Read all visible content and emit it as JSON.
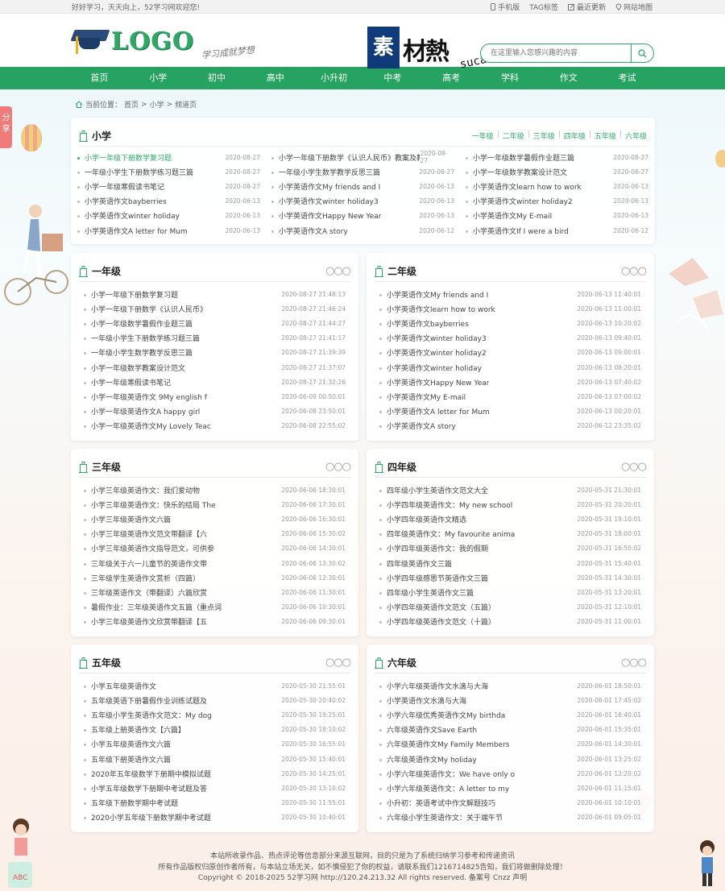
{
  "topbar": {
    "welcome": "好好学习，天天向上，52学习网欢迎您!",
    "links": [
      "手机版",
      "TAG标签",
      "最近更新",
      "网站地图"
    ]
  },
  "header": {
    "logo_text": "LOGO",
    "slogan": "学习成就梦想",
    "watermark_block": "素",
    "watermark_rest": "材熱",
    "watermark_domain": "sucaire.com",
    "search_placeholder": "在这里输入您感兴趣的内容"
  },
  "nav": [
    "首页",
    "小学",
    "初中",
    "高中",
    "小升初",
    "中考",
    "高考",
    "学科",
    "作文",
    "考试"
  ],
  "share": "分享",
  "breadcrumb": {
    "prefix": "当前位置：",
    "items": [
      "首页",
      "小学",
      "频道页"
    ],
    "sep": ">"
  },
  "top_card": {
    "title": "小学",
    "grades": [
      "一年级",
      "二年级",
      "三年级",
      "四年级",
      "五年级",
      "六年级"
    ],
    "columns": [
      [
        {
          "t": "小学一年级下册数学复习题",
          "d": "2020-08-27"
        },
        {
          "t": "一年级小学生下册数学练习题三篇",
          "d": "2020-08-27"
        },
        {
          "t": "小学一年级寒假读书笔记",
          "d": "2020-08-27"
        },
        {
          "t": "小学英语作文bayberries",
          "d": "2020-06-13"
        },
        {
          "t": "小学英语作文winter holiday",
          "d": "2020-06-13"
        },
        {
          "t": "小学英语作文A letter for Mum",
          "d": "2020-06-13"
        }
      ],
      [
        {
          "t": "小学一年级下册数学《认识人民币》教案及教",
          "d": "2020-08-27"
        },
        {
          "t": "一年级小学生数学教学反思三篇",
          "d": "2020-08-27"
        },
        {
          "t": "小学英语作文My friends and I",
          "d": "2020-06-13"
        },
        {
          "t": "小学英语作文winter holiday3",
          "d": "2020-06-13"
        },
        {
          "t": "小学英语作文Happy New Year",
          "d": "2020-06-13"
        },
        {
          "t": "小学英语作文A story",
          "d": "2020-06-12"
        }
      ],
      [
        {
          "t": "小学一年级数学暑假作业题三篇",
          "d": "2020-08-27"
        },
        {
          "t": "小学一年级数学教案设计范文",
          "d": "2020-08-27"
        },
        {
          "t": "小学英语作文learn how to work",
          "d": "2020-06-13"
        },
        {
          "t": "小学英语作文winter holiday2",
          "d": "2020-06-13"
        },
        {
          "t": "小学英语作文My E-mail",
          "d": "2020-06-13"
        },
        {
          "t": "小学英语作文If I were a bird",
          "d": "2020-06-12"
        }
      ]
    ]
  },
  "grade_cards": [
    {
      "title": "一年级",
      "more": "○○○",
      "items": [
        {
          "t": "小学一年级下册数学复习题",
          "d": "2020-08-27 21:48:13"
        },
        {
          "t": "小学一年级下册数学《认识人民币》",
          "d": "2020-08-27 21:46:24"
        },
        {
          "t": "小学一年级数学暑假作业题三篇",
          "d": "2020-08-27 21:44:27"
        },
        {
          "t": "一年级小学生下册数学练习题三篇",
          "d": "2020-08-27 21:41:17"
        },
        {
          "t": "一年级小学生数学教学反思三篇",
          "d": "2020-08-27 21:39:39"
        },
        {
          "t": "小学一年级数学教案设计范文",
          "d": "2020-08-27 21:37:07"
        },
        {
          "t": "小学一年级寒假读书笔记",
          "d": "2020-08-27 21:32:26"
        },
        {
          "t": "小学一年级英语作文 9My english f",
          "d": "2020-06-09 00:50:01"
        },
        {
          "t": "小学一年级英语作文A happy girl",
          "d": "2020-06-08 23:50:01"
        },
        {
          "t": "小学一年级英语作文My Lovely Teac",
          "d": "2020-06-08 22:55:02"
        }
      ]
    },
    {
      "title": "二年级",
      "more": "○○○",
      "items": [
        {
          "t": "小学英语作文My friends and I",
          "d": "2020-06-13 11:40:01"
        },
        {
          "t": "小学英语作文learn how to work",
          "d": "2020-06-13 11:00:01"
        },
        {
          "t": "小学英语作文bayberries",
          "d": "2020-06-13 10:20:02"
        },
        {
          "t": "小学英语作文winter holiday3",
          "d": "2020-06-13 09:40:01"
        },
        {
          "t": "小学英语作文winter holiday2",
          "d": "2020-06-13 09:00:01"
        },
        {
          "t": "小学英语作文winter holiday",
          "d": "2020-06-13 08:20:01"
        },
        {
          "t": "小学英语作文Happy New Year",
          "d": "2020-06-13 07:40:02"
        },
        {
          "t": "小学英语作文My E-mail",
          "d": "2020-06-13 07:00:02"
        },
        {
          "t": "小学英语作文A letter for Mum",
          "d": "2020-06-13 00:20:01"
        },
        {
          "t": "小学英语作文A story",
          "d": "2020-06-12 23:35:02"
        }
      ]
    },
    {
      "title": "三年级",
      "more": "○○○",
      "items": [
        {
          "t": "小学三年级英语作文：我们爱动物",
          "d": "2020-06-06 18:30:01"
        },
        {
          "t": "小学三年级英语作文：快乐的结局 The",
          "d": "2020-06-06 17:30:01"
        },
        {
          "t": "小学三年级英语作文六篇",
          "d": "2020-06-06 16:30:01"
        },
        {
          "t": "小学三年级英语作文范文带翻译【六",
          "d": "2020-06-06 15:30:02"
        },
        {
          "t": "小学三年级英语作文指导范文，可供参",
          "d": "2020-06-06 14:30:01"
        },
        {
          "t": "三年级关于六一儿童节的英语作文带",
          "d": "2020-06-06 13:30:02"
        },
        {
          "t": "三年级学生英语作文赏析（四篇）",
          "d": "2020-06-06 12:30:01"
        },
        {
          "t": "三年级英语作文（带翻译）六篇欣赏",
          "d": "2020-06-06 11:30:01"
        },
        {
          "t": "暑假作业：三年级英语作文五篇（重点词",
          "d": "2020-06-06 10:30:01"
        },
        {
          "t": "小学三年级英语作文欣赏带翻译【五",
          "d": "2020-06-06 09:30:01"
        }
      ]
    },
    {
      "title": "四年级",
      "more": "○○○",
      "items": [
        {
          "t": "四年级小学生英语作文范文大全",
          "d": "2020-05-31 21:30:01"
        },
        {
          "t": "小学四年级英语作文：My new school",
          "d": "2020-05-31 20:20:01"
        },
        {
          "t": "小学四年级英语作文精选",
          "d": "2020-05-31 19:10:01"
        },
        {
          "t": "四年级英语作文：My favourite anima",
          "d": "2020-05-31 18:00:01"
        },
        {
          "t": "小学四年级英语作文：我的假期",
          "d": "2020-05-31 16:50:02"
        },
        {
          "t": "四年级英语作文三篇",
          "d": "2020-05-31 15:40:01"
        },
        {
          "t": "小学四年级感恩节英语作文三篇",
          "d": "2020-05-31 14:30:01"
        },
        {
          "t": "四年级小学生英语作文三篇",
          "d": "2020-05-31 13:20:01"
        },
        {
          "t": "小学四年级英语作文范文（五篇）",
          "d": "2020-05-31 12:10:01"
        },
        {
          "t": "小学四年级英语作文范文（十篇）",
          "d": "2020-05-31 11:00:01"
        }
      ]
    },
    {
      "title": "五年级",
      "more": "○○○",
      "items": [
        {
          "t": "小学五年级英语作文",
          "d": "2020-05-30 21:55:01"
        },
        {
          "t": "五年级英语下册暑假作业训练试题及",
          "d": "2020-05-30 20:40:02"
        },
        {
          "t": "五年级小学生英语作文范文：My dog",
          "d": "2020-05-30 19:25:01"
        },
        {
          "t": "五年级上册英语作文【六篇】",
          "d": "2020-05-30 18:10:02"
        },
        {
          "t": "小学五年级英语作文六篇",
          "d": "2020-05-30 16:55:01"
        },
        {
          "t": "五年级下册英语作文六篇",
          "d": "2020-05-30 15:40:01"
        },
        {
          "t": "2020年五年级数学下册期中模拟试题",
          "d": "2020-05-30 14:25:01"
        },
        {
          "t": "小学五年级数学下册期中考试题及答",
          "d": "2020-05-30 13:10:02"
        },
        {
          "t": "五年级下册数学期中考试题",
          "d": "2020-05-30 11:55:01"
        },
        {
          "t": "2020小学五年级下册数学期中考试题",
          "d": "2020-05-30 10:40:01"
        }
      ]
    },
    {
      "title": "六年级",
      "more": "○○○",
      "items": [
        {
          "t": "小学六年级英语作文水滴与大海",
          "d": "2020-06-01 18:50:01"
        },
        {
          "t": "小学英语作文水滴与大海",
          "d": "2020-06-01 17:45:02"
        },
        {
          "t": "小学六年级优秀英语作文My birthda",
          "d": "2020-06-01 16:40:01"
        },
        {
          "t": "六年级英语作文Save Earth",
          "d": "2020-06-01 15:35:01"
        },
        {
          "t": "六年级英语作文My Family Members",
          "d": "2020-06-01 14:30:01"
        },
        {
          "t": "六年级英语作文My holiday",
          "d": "2020-06-01 13:25:02"
        },
        {
          "t": "小学六年级英语作文：We have only o",
          "d": "2020-06-01 12:20:02"
        },
        {
          "t": "小学六年级英语作文：A letter to my",
          "d": "2020-06-01 11:15:01"
        },
        {
          "t": "小升初：英语考试中作文解题技巧",
          "d": "2020-06-01 10:10:01"
        },
        {
          "t": "六年级小学生英语作文：关于端午节",
          "d": "2020-06-01 09:05:01"
        }
      ]
    }
  ],
  "footer": {
    "line1": "本站所收录作品、热点评论等信息部分来源互联网，目的只是为了系统归纳学习参考和传递资讯",
    "line2": "所有作品版权归原创作者所有，与本站立场无关，如不慎侵犯了你的权益，请联系我们1216714825告知，我们将做删除处理！",
    "line3": "Copyright © 2018-2025 52学习网 http://120.24.213.32 All rights reserved. 备案号 Cnzz 声明"
  },
  "colors": {
    "accent": "#27a361",
    "share": "#f07b7b",
    "watermark": "#0f3b7a"
  },
  "icons": [
    "phone-icon",
    "tag-icon",
    "edit-icon",
    "location-icon",
    "search-icon",
    "home-icon",
    "building-icon",
    "more-dots-icon"
  ]
}
